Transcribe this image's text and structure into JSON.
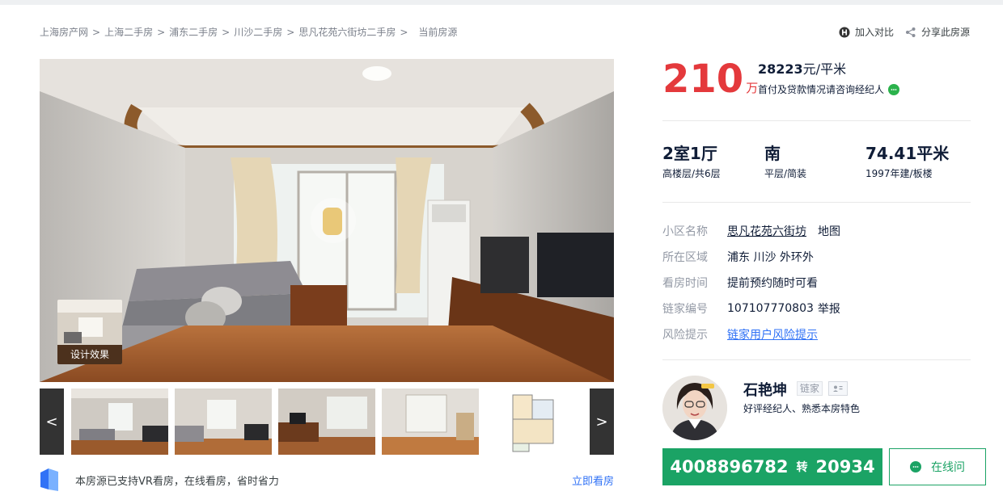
{
  "breadcrumb": {
    "items": [
      "上海房产网",
      "上海二手房",
      "浦东二手房",
      "川沙二手房",
      "思凡花苑六街坊二手房"
    ],
    "separator": ">",
    "current": "当前房源"
  },
  "tools": {
    "compare": "加入对比",
    "share": "分享此房源"
  },
  "gallery": {
    "design_label": "设计效果",
    "prev": "<",
    "next": ">",
    "vr_text": "本房源已支持VR看房，在线看房，省时省力",
    "vr_link": "立即看房"
  },
  "price": {
    "total": "210",
    "total_unit": "万",
    "unit_price": "28223",
    "unit_price_unit": "元/平米",
    "loan_note": "首付及贷款情况请咨询经纪人"
  },
  "specs": [
    {
      "main": "2室1厅",
      "sub": "高楼层/共6层"
    },
    {
      "main": "南",
      "sub": "平层/简装"
    },
    {
      "main": "74.41平米",
      "sub": "1997年建/板楼"
    }
  ],
  "info": {
    "community_label": "小区名称",
    "community": "思凡花苑六街坊",
    "map": "地图",
    "area_label": "所在区域",
    "area": "浦东 川沙 外环外",
    "visit_label": "看房时间",
    "visit": "提前预约随时可看",
    "id_label": "链家编号",
    "id": "107107770803",
    "report": "举报",
    "risk_label": "风险提示",
    "risk": "链家用户风险提示"
  },
  "agent": {
    "name": "石艳坤",
    "brand": "链家",
    "desc": "好评经纪人、熟悉本房特色",
    "phone_main": "4008896782",
    "phone_zhuan": "转",
    "phone_ext": "20934",
    "online": "在线问"
  },
  "colors": {
    "price": "#e4393c",
    "green": "#1ba365",
    "link": "#3072f6"
  }
}
